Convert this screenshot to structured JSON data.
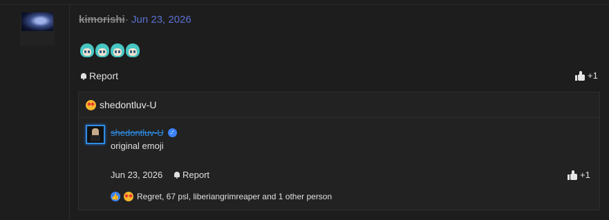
{
  "post": {
    "username": "kimorishi",
    "separator": "·",
    "date": "Jun 23, 2026",
    "emoji_icons": [
      "miku-emoji-icon",
      "miku-emoji-icon",
      "miku-emoji-icon",
      "miku-emoji-icon"
    ],
    "report_label": "Report",
    "like_count": "+1"
  },
  "quote": {
    "header_name": "shedontluv-U",
    "author_name": "shedontluv-U",
    "text": "original emoji",
    "date": "Jun 23, 2026",
    "report_label": "Report",
    "like_count": "+1",
    "reactions_text": "Regret, 67 psl, liberiangrimreaper and 1 other person"
  },
  "colors": {
    "accent_blue": "#2f8de4",
    "date_link": "#5b6fd1",
    "background": "#1d1d1d"
  }
}
